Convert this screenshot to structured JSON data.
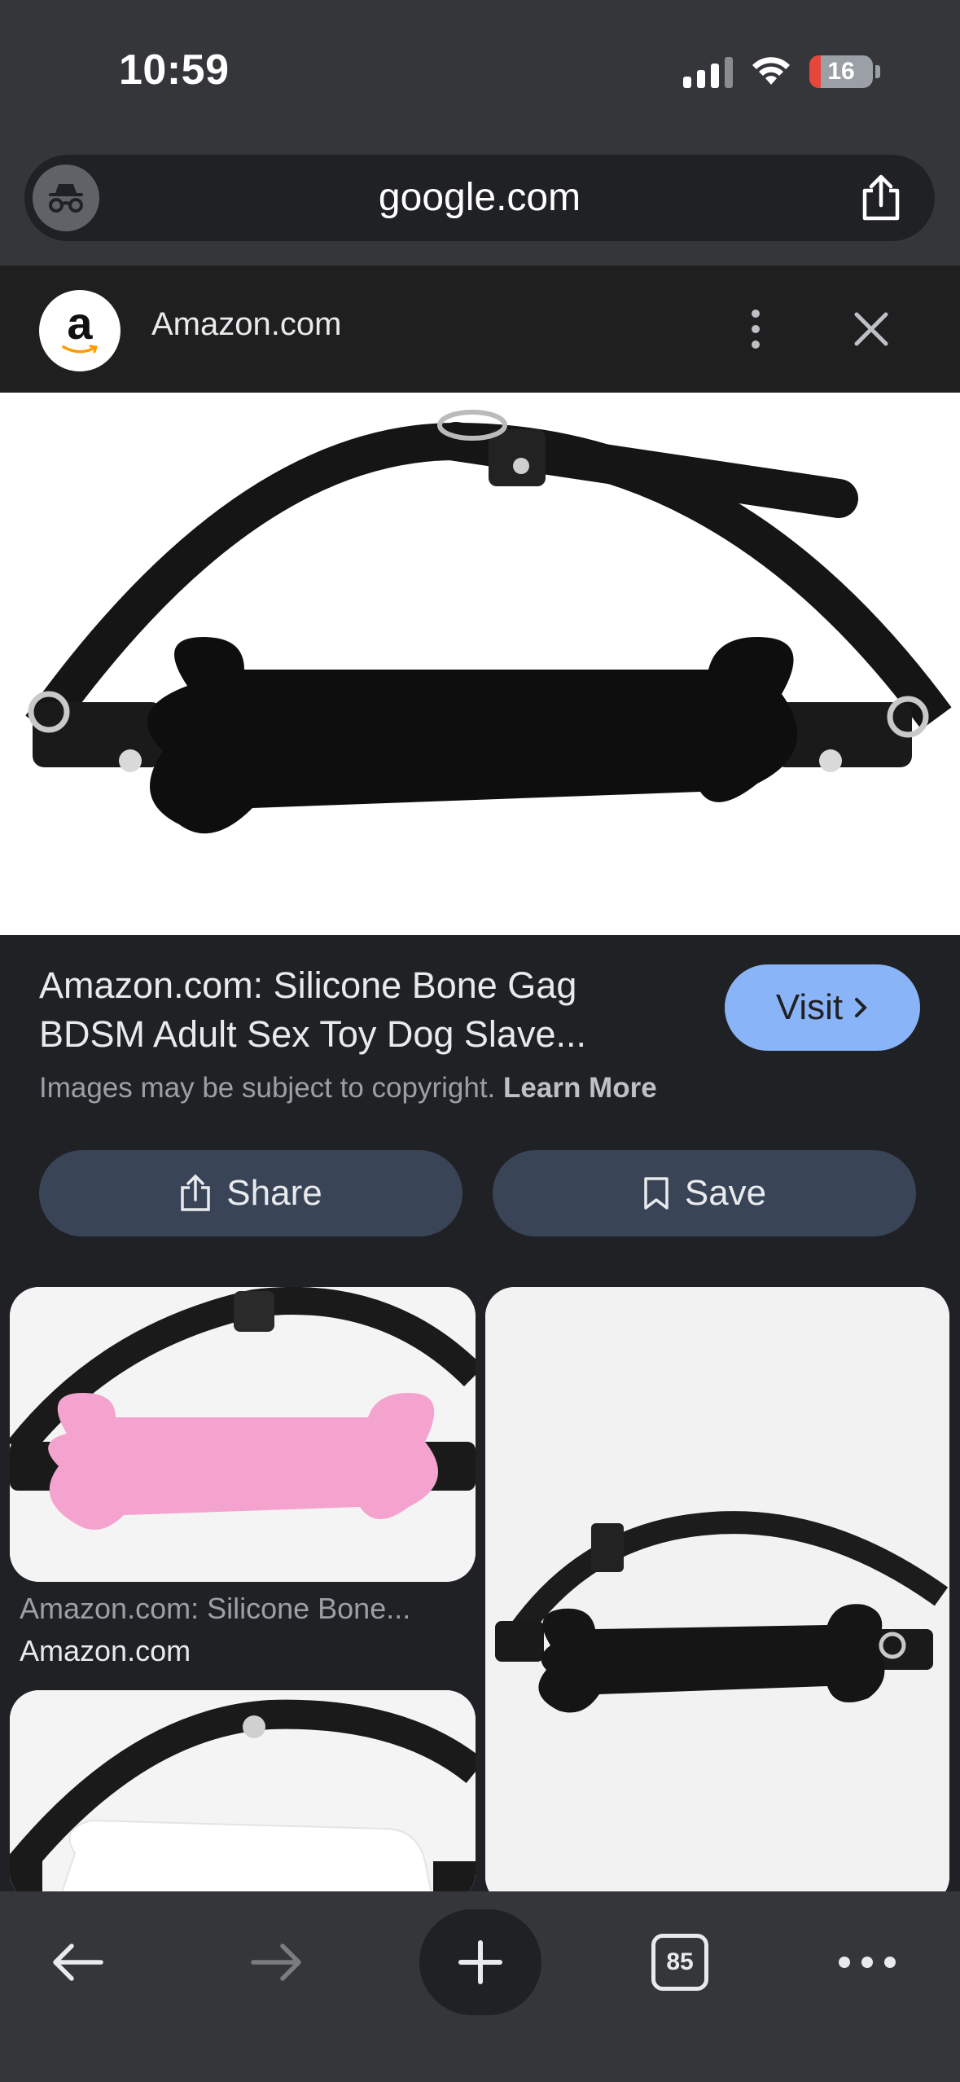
{
  "status_bar": {
    "time": "10:59",
    "battery": "16",
    "battery_level": 0.16
  },
  "address_bar": {
    "url": "google.com"
  },
  "source": {
    "name": "Amazon.com",
    "logo_letter": "a"
  },
  "result": {
    "title_line1": "Amazon.com: Silicone Bone Gag",
    "title_line2": "BDSM Adult Sex Toy Dog Slave...",
    "visit_label": "Visit",
    "copyright_text": "Images may be subject to copyright.",
    "learn_more": "Learn More",
    "share_label": "Share",
    "save_label": "Save"
  },
  "related": [
    {
      "title": "Amazon.com: Silicone Bone...",
      "source": "Amazon.com"
    }
  ],
  "toolbar": {
    "tab_count": "85"
  },
  "colors": {
    "accent": "#8ab4f8",
    "pill": "#394457",
    "chrome": "#35363a",
    "background": "#202124"
  }
}
